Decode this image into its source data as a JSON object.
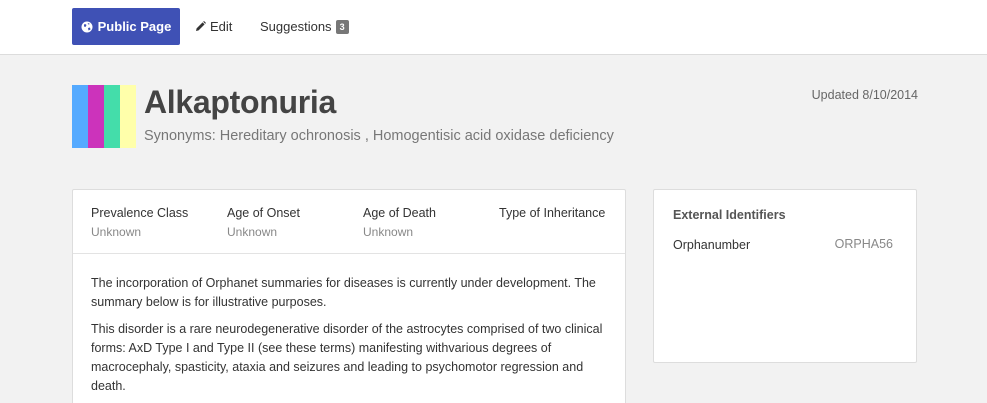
{
  "nav": {
    "public_page": "Public Page",
    "edit": "Edit",
    "suggestions": "Suggestions",
    "suggestions_count": "3",
    "icons": {
      "public_page": "globe-icon",
      "edit": "pencil-icon"
    },
    "colors": {
      "primary": "#3f51b5"
    }
  },
  "header": {
    "title": "Alkaptonuria",
    "synonyms": "Synonyms: Hereditary ochronosis , Homogentisic acid oxidase deficiency",
    "updated": "Updated 8/10/2014",
    "color_bar": [
      "#55aaff",
      "#cc33bb",
      "#44ddaa",
      "#ffffaa"
    ]
  },
  "stats": [
    {
      "label": "Prevalence Class",
      "value": "Unknown"
    },
    {
      "label": "Age of Onset",
      "value": "Unknown"
    },
    {
      "label": "Age of Death",
      "value": "Unknown"
    },
    {
      "label": "Type of Inheritance",
      "value": ""
    }
  ],
  "summary": {
    "p1": "The incorporation of Orphanet summaries for diseases is currently under development. The summary below is for illustrative purposes.",
    "p2": "This disorder is a rare neurodegenerative disorder of the astrocytes comprised of two clinical forms: AxD Type I and Type II (see these terms) manifesting withvarious degrees of macrocephaly, spasticity, ataxia and seizures and leading to psychomotor regression and death."
  },
  "external": {
    "title": "External Identifiers",
    "key": "Orphanumber",
    "value": "ORPHA56"
  }
}
